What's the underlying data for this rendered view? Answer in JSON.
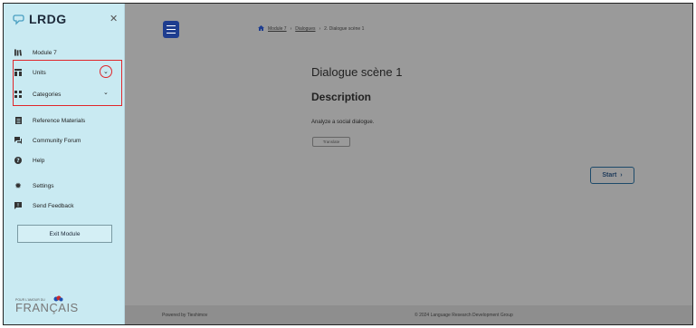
{
  "brand": {
    "name": "LRDG"
  },
  "sidebar": {
    "items": [
      {
        "label": "Module 7"
      },
      {
        "label": "Units"
      },
      {
        "label": "Categories"
      },
      {
        "label": "Reference Materials"
      },
      {
        "label": "Community Forum"
      },
      {
        "label": "Help"
      },
      {
        "label": "Settings"
      },
      {
        "label": "Send Feedback"
      }
    ],
    "exit_label": "Exit Module",
    "partner_logo": {
      "small": "POUR L'AMOUR DU",
      "big": "FRANÇAIS"
    }
  },
  "breadcrumb": {
    "items": [
      "Module 7",
      "Dialogues",
      "2. Dialogue scène 1"
    ]
  },
  "main": {
    "title": "Dialogue scène 1",
    "heading": "Description",
    "text": "Analyze a social dialogue.",
    "translate_label": "Translate",
    "start_label": "Start"
  },
  "footer": {
    "left": "Powered by Tieshimov",
    "right": "© 2024 Language Research Development Group"
  },
  "colors": {
    "accent": "#1e3d8f",
    "sidebar_bg": "#c9eaf2",
    "highlight": "#e0262b"
  }
}
